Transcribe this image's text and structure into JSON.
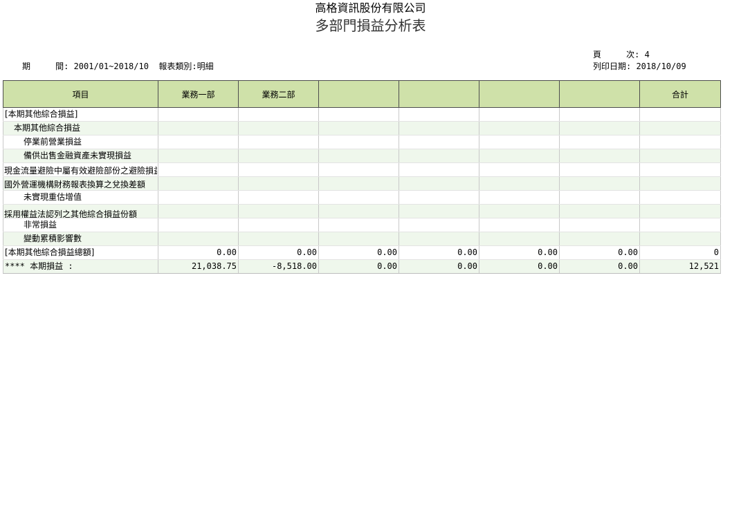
{
  "header": {
    "company": "高格資訊股份有限公司",
    "title": "多部門損益分析表",
    "period_line": "期     間: 2001/01~2018/10  報表類別:明細",
    "page_line": "頁     次: 4",
    "print_date_line": "列印日期: 2018/10/09"
  },
  "table": {
    "columns": [
      "項目",
      "業務一部",
      "業務二部",
      "",
      "",
      "",
      "",
      "合計"
    ],
    "rows": [
      {
        "label": "[本期其他綜合損益]",
        "values": [
          "",
          "",
          "",
          "",
          "",
          "",
          ""
        ]
      },
      {
        "label": "本期其他綜合損益",
        "values": [
          "",
          "",
          "",
          "",
          "",
          "",
          ""
        ]
      },
      {
        "label": "停業前營業損益",
        "values": [
          "",
          "",
          "",
          "",
          "",
          "",
          ""
        ]
      },
      {
        "label": "備供出售金融資產未實現損益",
        "values": [
          "",
          "",
          "",
          "",
          "",
          "",
          ""
        ]
      },
      {
        "label": "現金流量避險中屬有效避險部份之避險損益",
        "values": [
          "",
          "",
          "",
          "",
          "",
          "",
          ""
        ]
      },
      {
        "label": "國外營運機構財務報表換算之兌換差額",
        "values": [
          "",
          "",
          "",
          "",
          "",
          "",
          ""
        ]
      },
      {
        "label": "未實現重估增值",
        "values": [
          "",
          "",
          "",
          "",
          "",
          "",
          ""
        ]
      },
      {
        "label": "採用權益法認列之其他綜合損益份額",
        "values": [
          "",
          "",
          "",
          "",
          "",
          "",
          ""
        ]
      },
      {
        "label": "非常損益",
        "values": [
          "",
          "",
          "",
          "",
          "",
          "",
          ""
        ]
      },
      {
        "label": "變動累積影響數",
        "values": [
          "",
          "",
          "",
          "",
          "",
          "",
          ""
        ]
      },
      {
        "label": "[本期其他綜合損益總額]",
        "values": [
          "0.00",
          "0.00",
          "0.00",
          "0.00",
          "0.00",
          "0.00",
          "0"
        ]
      },
      {
        "label": "**** 本期損益 :",
        "values": [
          "21,038.75",
          "-8,518.00",
          "0.00",
          "0.00",
          "0.00",
          "0.00",
          "12,521"
        ]
      }
    ]
  }
}
